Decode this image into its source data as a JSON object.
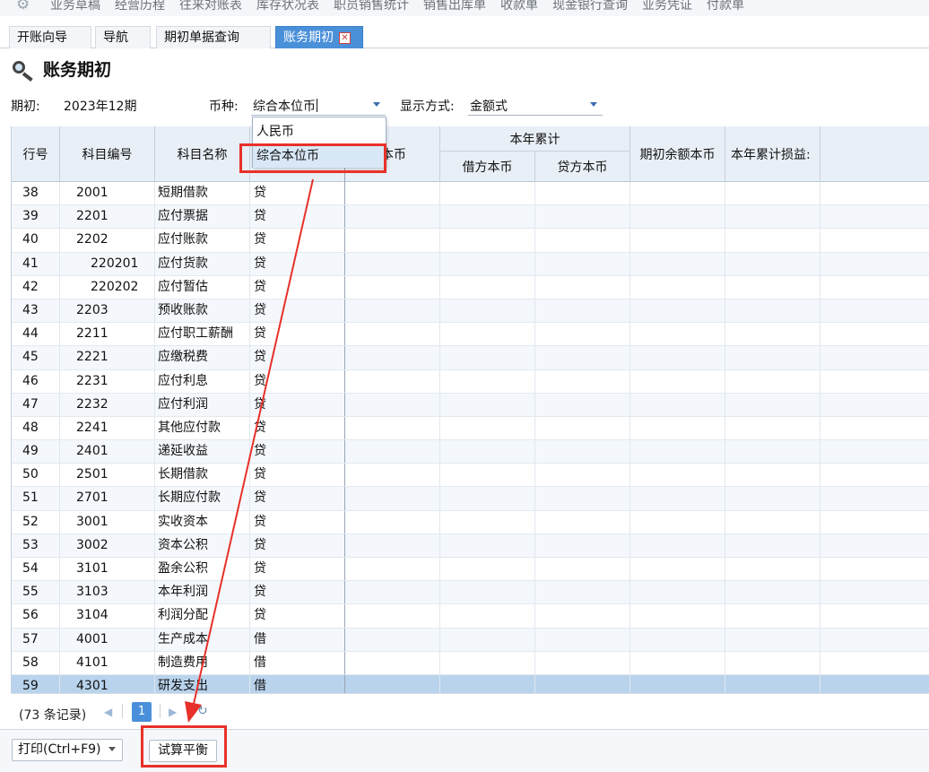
{
  "top_menu": {
    "items": [
      "业务草稿",
      "经营历程",
      "往来对账表",
      "库存状况表",
      "职员销售统计",
      "销售出库单",
      "收款单",
      "现金银行查询",
      "业务凭证",
      "付款单"
    ]
  },
  "tabs": [
    {
      "label": "开账向导",
      "active": false
    },
    {
      "label": "导航",
      "active": false
    },
    {
      "label": "期初单据查询",
      "active": false
    },
    {
      "label": "账务期初",
      "active": true
    }
  ],
  "page_title": "账务期初",
  "filters": {
    "period_label": "期初:",
    "period_value": "2023年12期",
    "currency_label": "币种:",
    "currency_value": "综合本位币",
    "display_label": "显示方式:",
    "display_value": "金额式"
  },
  "currency_dropdown": {
    "options": [
      "人民币",
      "综合本位币"
    ],
    "highlighted": "综合本位币"
  },
  "grid": {
    "headers": {
      "row_no": "行号",
      "code": "科目编号",
      "name": "科目名称",
      "direction_partial": "",
      "opening_partial": "本币",
      "ytd_group": "本年累计",
      "ytd_debit": "借方本币",
      "ytd_credit": "贷方本币",
      "opening_balance": "期初余额本币",
      "ytd_pl": "本年累计损益:"
    },
    "rows": [
      {
        "no": "38",
        "code": "2001",
        "name": "短期借款",
        "dir": "贷",
        "indent": false,
        "selected": false
      },
      {
        "no": "39",
        "code": "2201",
        "name": "应付票据",
        "dir": "贷",
        "indent": false,
        "selected": false
      },
      {
        "no": "40",
        "code": "2202",
        "name": "应付账款",
        "dir": "贷",
        "indent": false,
        "selected": false
      },
      {
        "no": "41",
        "code": "220201",
        "name": "应付货款",
        "dir": "贷",
        "indent": true,
        "selected": false
      },
      {
        "no": "42",
        "code": "220202",
        "name": "应付暂估",
        "dir": "贷",
        "indent": true,
        "selected": false
      },
      {
        "no": "43",
        "code": "2203",
        "name": "预收账款",
        "dir": "贷",
        "indent": false,
        "selected": false
      },
      {
        "no": "44",
        "code": "2211",
        "name": "应付职工薪酬",
        "dir": "贷",
        "indent": false,
        "selected": false
      },
      {
        "no": "45",
        "code": "2221",
        "name": "应缴税费",
        "dir": "贷",
        "indent": false,
        "selected": false
      },
      {
        "no": "46",
        "code": "2231",
        "name": "应付利息",
        "dir": "贷",
        "indent": false,
        "selected": false
      },
      {
        "no": "47",
        "code": "2232",
        "name": "应付利润",
        "dir": "贷",
        "indent": false,
        "selected": false
      },
      {
        "no": "48",
        "code": "2241",
        "name": "其他应付款",
        "dir": "贷",
        "indent": false,
        "selected": false
      },
      {
        "no": "49",
        "code": "2401",
        "name": "递延收益",
        "dir": "贷",
        "indent": false,
        "selected": false
      },
      {
        "no": "50",
        "code": "2501",
        "name": "长期借款",
        "dir": "贷",
        "indent": false,
        "selected": false
      },
      {
        "no": "51",
        "code": "2701",
        "name": "长期应付款",
        "dir": "贷",
        "indent": false,
        "selected": false
      },
      {
        "no": "52",
        "code": "3001",
        "name": "实收资本",
        "dir": "贷",
        "indent": false,
        "selected": false
      },
      {
        "no": "53",
        "code": "3002",
        "name": "资本公积",
        "dir": "贷",
        "indent": false,
        "selected": false
      },
      {
        "no": "54",
        "code": "3101",
        "name": "盈余公积",
        "dir": "贷",
        "indent": false,
        "selected": false
      },
      {
        "no": "55",
        "code": "3103",
        "name": "本年利润",
        "dir": "贷",
        "indent": false,
        "selected": false
      },
      {
        "no": "56",
        "code": "3104",
        "name": "利润分配",
        "dir": "贷",
        "indent": false,
        "selected": false
      },
      {
        "no": "57",
        "code": "4001",
        "name": "生产成本",
        "dir": "借",
        "indent": false,
        "selected": false
      },
      {
        "no": "58",
        "code": "4101",
        "name": "制造费用",
        "dir": "借",
        "indent": false,
        "selected": false
      },
      {
        "no": "59",
        "code": "4301",
        "name": "研发支出",
        "dir": "借",
        "indent": false,
        "selected": true
      }
    ]
  },
  "pager": {
    "records": "(73 条记录)",
    "current_page": "1"
  },
  "toolbar": {
    "print_label": "打印(Ctrl+F9)",
    "trial_balance_label": "试算平衡"
  },
  "colors": {
    "accent": "#4a90d9",
    "annotation": "#e8312a",
    "selected_row": "#b9d3ec",
    "header_bg": "#e9eff6"
  }
}
